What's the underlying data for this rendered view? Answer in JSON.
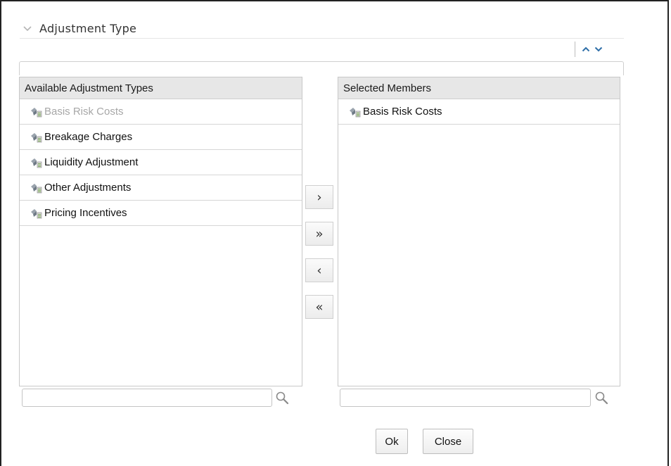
{
  "section": {
    "title": "Adjustment Type",
    "collapse_icon": "chevron-down-icon"
  },
  "sort_controls": {
    "up_icon": "chevron-up-icon",
    "down_icon": "chevron-down-icon",
    "color": "#2f6fa8"
  },
  "available": {
    "header": "Available Adjustment Types",
    "items": [
      {
        "label": "Basis Risk Costs",
        "state": "disabled"
      },
      {
        "label": "Breakage Charges",
        "state": "normal"
      },
      {
        "label": "Liquidity Adjustment",
        "state": "normal"
      },
      {
        "label": "Other Adjustments",
        "state": "normal"
      },
      {
        "label": "Pricing Incentives",
        "state": "normal"
      }
    ],
    "search": {
      "value": "",
      "placeholder": ""
    }
  },
  "selected": {
    "header": "Selected Members",
    "items": [
      {
        "label": "Basis Risk Costs",
        "state": "normal"
      }
    ],
    "search": {
      "value": "",
      "placeholder": ""
    }
  },
  "move_buttons": {
    "move_one": "›",
    "move_all": "»",
    "remove_one": "‹",
    "remove_all": "«"
  },
  "actions": {
    "ok": "Ok",
    "close": "Close"
  },
  "icons": {
    "item_icon": "hierarchy-member-icon",
    "search_icon": "magnifier-icon"
  }
}
